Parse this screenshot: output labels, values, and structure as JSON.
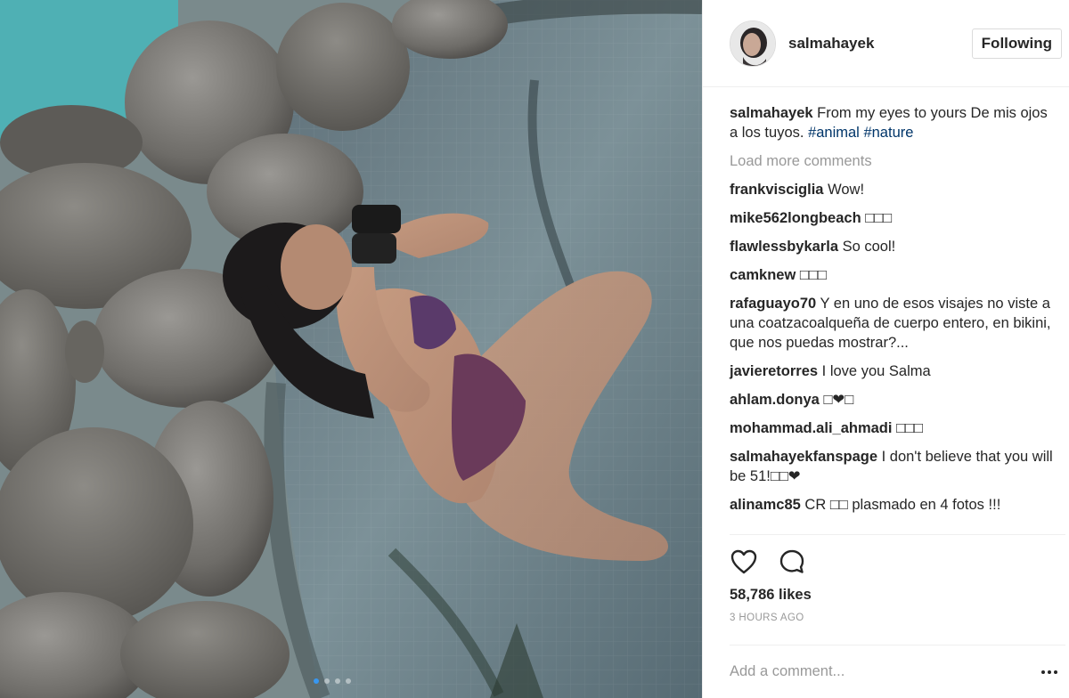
{
  "post": {
    "username": "salmahayek",
    "follow_label": "Following",
    "caption": {
      "user": "salmahayek",
      "text": "From my eyes to yours De mis ojos a los tuyos.",
      "hashtags": [
        "#animal",
        "#nature"
      ]
    },
    "load_more_label": "Load more comments",
    "comments": [
      {
        "user": "frankviscigliа",
        "text": "Wow!"
      },
      {
        "user": "mike562longbeach",
        "text": "□□□"
      },
      {
        "user": "flawlessbykarla",
        "text": "So cool!"
      },
      {
        "user": "camknew",
        "text": "□□□"
      },
      {
        "user": "rafaguayo70",
        "text": "Y en uno de esos visajes no viste a una coatzacoalqueña de cuerpo entero, en bikini, que nos puedas mostrar?..."
      },
      {
        "user": "javieretorres",
        "text": "I love you Salma"
      },
      {
        "user": "ahlam.donya",
        "text": "□❤□"
      },
      {
        "user": "mohammad.ali_ahmadi",
        "text": "□□□"
      },
      {
        "user": "salmahayekfanspage",
        "text": "I don't believe that you will be 51!□□❤"
      },
      {
        "user": "alinamc85",
        "text": "CR □□ plasmado en 4 fotos !!!"
      }
    ],
    "likes": "58,786 likes",
    "timestamp": "3 HOURS AGO",
    "add_comment_placeholder": "Add a comment...",
    "icons": {
      "like": "heart-icon",
      "comment": "comment-icon",
      "more": "more-options-icon"
    },
    "colors": {
      "hashtag": "#003569",
      "muted": "#999999",
      "text": "#262626",
      "carousel_active": "#3897f0"
    }
  }
}
